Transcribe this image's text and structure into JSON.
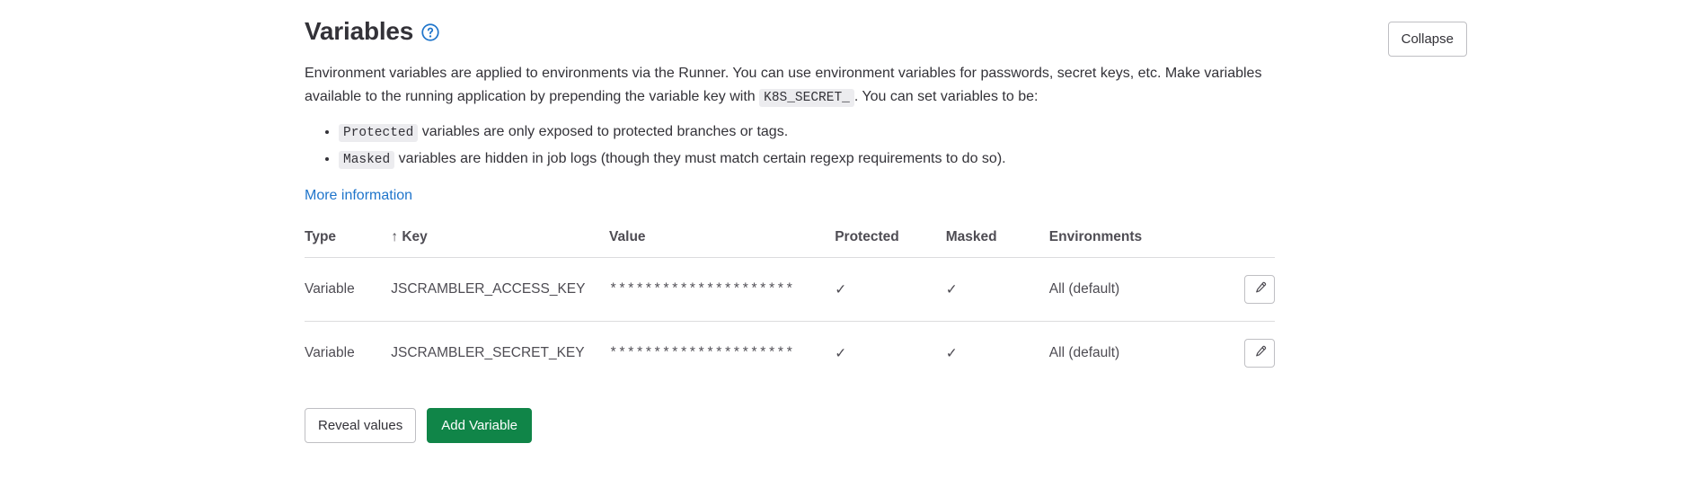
{
  "section": {
    "title": "Variables",
    "help_icon": "question-circle-icon",
    "collapse_label": "Collapse"
  },
  "description": {
    "line1_part1": "Environment variables are applied to environments via the Runner. You can use environment variables for passwords, secret keys, etc. Make variables available to the running application by prepending the variable key with",
    "code_prefix": "K8S_SECRET_",
    "line1_part2": ". You can set variables to be:",
    "notes": [
      {
        "code": "Protected",
        "text": "variables are only exposed to protected branches or tags."
      },
      {
        "code": "Masked",
        "text": "variables are hidden in job logs (though they must match certain regexp requirements to do so)."
      }
    ],
    "more_information": "More information"
  },
  "table": {
    "headers": {
      "type": "Type",
      "key": "↑ Key",
      "value": "Value",
      "protected": "Protected",
      "masked": "Masked",
      "environments": "Environments"
    },
    "rows": [
      {
        "type": "Variable",
        "key": "JSCRAMBLER_ACCESS_KEY",
        "value": "*********************",
        "protected": "✓",
        "masked": "✓",
        "environments": "All (default)",
        "edit_icon": "pencil-icon"
      },
      {
        "type": "Variable",
        "key": "JSCRAMBLER_SECRET_KEY",
        "value": "*********************",
        "protected": "✓",
        "masked": "✓",
        "environments": "All (default)",
        "edit_icon": "pencil-icon"
      }
    ]
  },
  "footer": {
    "reveal_label": "Reveal values",
    "add_label": "Add Variable"
  },
  "colors": {
    "link": "#1f75cb",
    "primary_button": "#108548",
    "text": "#333238",
    "muted": "#737278",
    "border": "#bfbfc3"
  }
}
